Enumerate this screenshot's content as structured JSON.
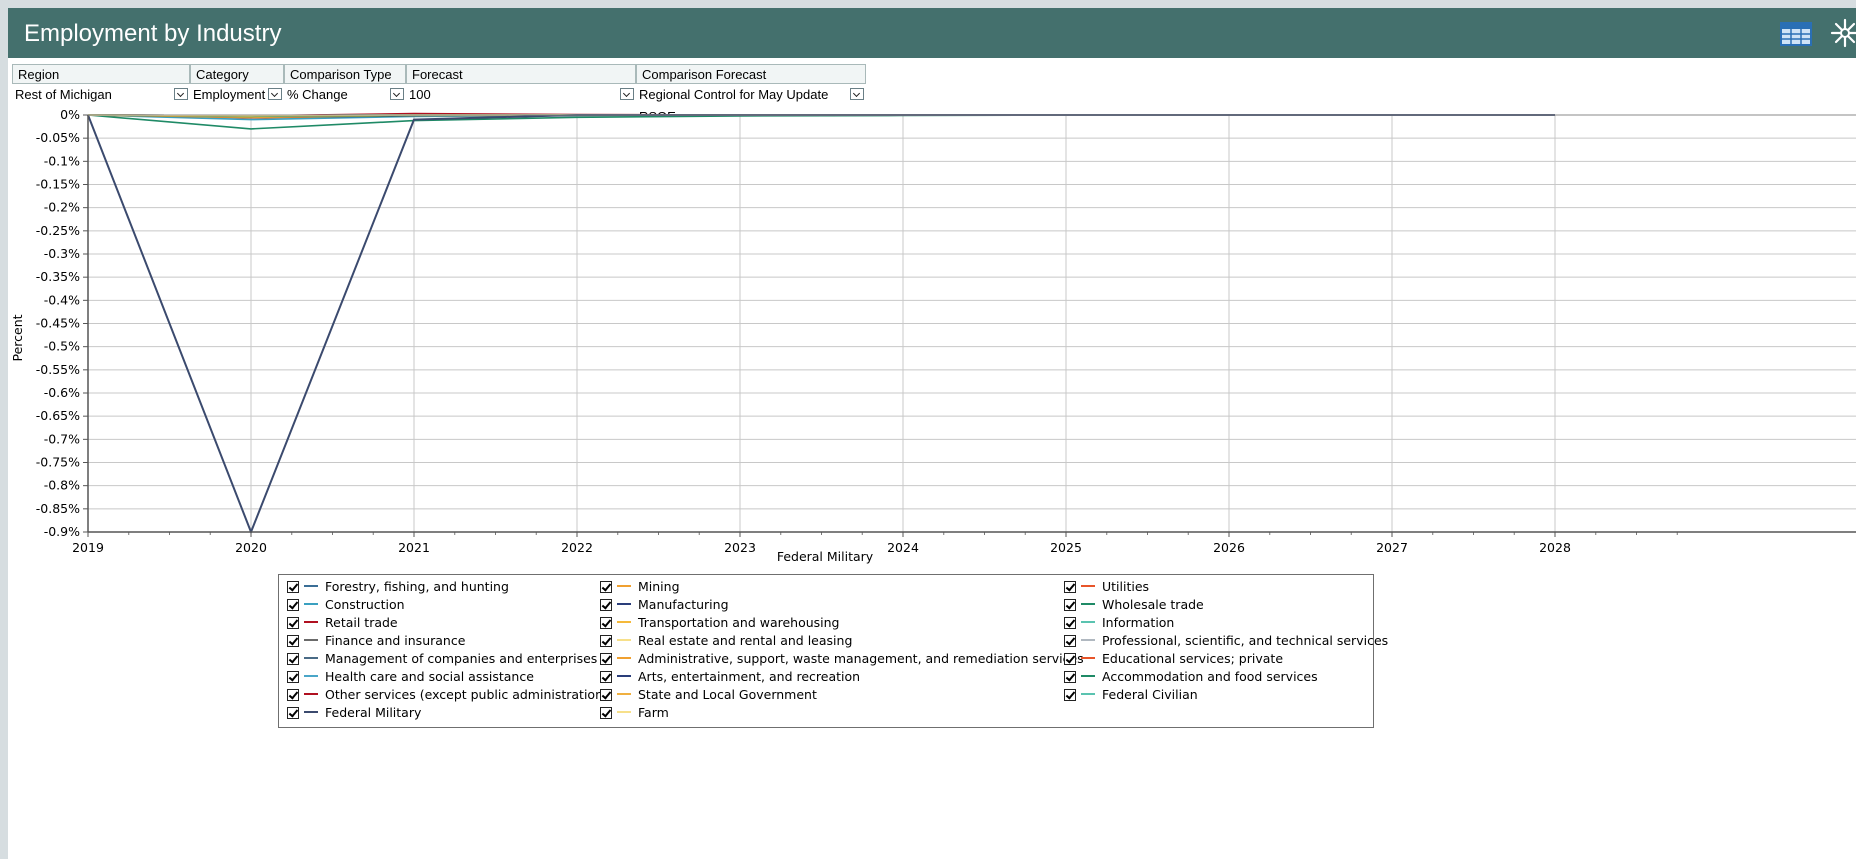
{
  "header": {
    "title": "Employment by Industry",
    "background": "#44706d",
    "table_icon": "table-grid-icon",
    "expand_icon": "expand-arrows-icon"
  },
  "selectors": {
    "region": {
      "label": "Region",
      "value": "Rest of Michigan"
    },
    "category": {
      "label": "Category",
      "value": "Employment"
    },
    "comparison_type": {
      "label": "Comparison Type",
      "value": "% Change"
    },
    "forecast": {
      "label": "Forecast",
      "value": "100"
    },
    "comparison_forecast": {
      "label": "Comparison Forecast",
      "value": "Regional Control for May Update RSQE"
    }
  },
  "chart_data": {
    "type": "line",
    "title": "",
    "xlabel": "Federal Military",
    "ylabel": "Percent",
    "x": [
      2019,
      2020,
      2021,
      2022,
      2023,
      2024,
      2025,
      2026,
      2027,
      2028
    ],
    "xlim": [
      2019,
      2028
    ],
    "ylim": [
      -0.9,
      0
    ],
    "y_ticks": [
      "0%",
      "-0.05%",
      "-0.1%",
      "-0.15%",
      "-0.2%",
      "-0.25%",
      "-0.3%",
      "-0.35%",
      "-0.4%",
      "-0.45%",
      "-0.5%",
      "-0.55%",
      "-0.6%",
      "-0.65%",
      "-0.7%",
      "-0.75%",
      "-0.8%",
      "-0.85%",
      "-0.9%"
    ],
    "x_ticks": [
      "2019",
      "2020",
      "2021",
      "2022",
      "2023",
      "2024",
      "2025",
      "2026",
      "2027",
      "2028"
    ],
    "grid": true,
    "legend_position": "bottom",
    "series": [
      {
        "name": "Forestry, fishing, and hunting",
        "color": "#3a6e96",
        "values": [
          0,
          -0.004,
          -0.001,
          0,
          0,
          0,
          0,
          0,
          0,
          0
        ]
      },
      {
        "name": "Mining",
        "color": "#f0a030",
        "values": [
          0,
          -0.003,
          -0.001,
          0,
          0,
          0,
          0,
          0,
          0,
          0
        ]
      },
      {
        "name": "Utilities",
        "color": "#e8552a",
        "values": [
          0,
          -0.006,
          -0.002,
          -0.001,
          0,
          0,
          0,
          0,
          0,
          0
        ]
      },
      {
        "name": "Construction",
        "color": "#3aa0c0",
        "values": [
          0,
          -0.01,
          -0.003,
          -0.001,
          0,
          0,
          0,
          0,
          0,
          0
        ]
      },
      {
        "name": "Manufacturing",
        "color": "#2a3d7a",
        "values": [
          0,
          -0.005,
          -0.002,
          0,
          0,
          0,
          0,
          0,
          0,
          0
        ]
      },
      {
        "name": "Wholesale trade",
        "color": "#1f8a66",
        "values": [
          0,
          -0.03,
          -0.012,
          -0.005,
          -0.002,
          -0.001,
          0,
          0,
          0,
          0
        ]
      },
      {
        "name": "Retail trade",
        "color": "#b01020",
        "values": [
          0,
          -0.002,
          0.003,
          0.001,
          0,
          0,
          0,
          0,
          0,
          0
        ]
      },
      {
        "name": "Transportation and warehousing",
        "color": "#f5b93a",
        "values": [
          0,
          -0.004,
          -0.001,
          0,
          0,
          0,
          0,
          0,
          0,
          0
        ]
      },
      {
        "name": "Information",
        "color": "#5ac3b0",
        "values": [
          0,
          -0.002,
          -0.001,
          0,
          0,
          0,
          0,
          0,
          0,
          0
        ]
      },
      {
        "name": "Finance and insurance",
        "color": "#6a6a6a",
        "values": [
          0,
          -0.001,
          0,
          0,
          0,
          0,
          0,
          0,
          0,
          0
        ]
      },
      {
        "name": "Real estate and rental and leasing",
        "color": "#f7e08a",
        "values": [
          0,
          -0.001,
          0,
          0,
          0,
          0,
          0,
          0,
          0,
          0
        ]
      },
      {
        "name": "Professional, scientific, and technical services",
        "color": "#b0b8c0",
        "values": [
          0,
          -0.003,
          -0.001,
          0,
          0,
          0,
          0,
          0,
          0,
          0
        ]
      },
      {
        "name": "Management of companies and enterprises",
        "color": "#4a6b86",
        "values": [
          0,
          -0.001,
          0,
          0,
          0,
          0,
          0,
          0,
          0,
          0
        ]
      },
      {
        "name": "Administrative, support, waste management, and remediation services",
        "color": "#f0a030",
        "values": [
          0,
          -0.005,
          -0.001,
          0,
          0,
          0,
          0,
          0,
          0,
          0
        ]
      },
      {
        "name": "Educational services; private",
        "color": "#e8552a",
        "values": [
          0,
          -0.002,
          0,
          0,
          0,
          0,
          0,
          0,
          0,
          0
        ]
      },
      {
        "name": "Health care and social assistance",
        "color": "#4aa6c8",
        "values": [
          0,
          -0.002,
          0,
          0,
          0,
          0,
          0,
          0,
          0,
          0
        ]
      },
      {
        "name": "Arts, entertainment, and recreation",
        "color": "#2a3d7a",
        "values": [
          0,
          -0.001,
          0,
          0,
          0,
          0,
          0,
          0,
          0,
          0
        ]
      },
      {
        "name": "Accommodation and food services",
        "color": "#1f8a66",
        "values": [
          0,
          -0.003,
          -0.001,
          0,
          0,
          0,
          0,
          0,
          0,
          0
        ]
      },
      {
        "name": "Other services (except public administration)",
        "color": "#b01020",
        "values": [
          0,
          -0.001,
          0,
          0,
          0,
          0,
          0,
          0,
          0,
          0
        ]
      },
      {
        "name": "State and Local Government",
        "color": "#f0b040",
        "values": [
          0,
          -0.002,
          0,
          0,
          0,
          0,
          0,
          0,
          0,
          0
        ]
      },
      {
        "name": "Federal Civilian",
        "color": "#5ac3b0",
        "values": [
          0,
          -0.001,
          0,
          0,
          0,
          0,
          0,
          0,
          0,
          0
        ]
      },
      {
        "name": "Federal Military",
        "color": "#3b4a6e",
        "values": [
          0,
          -0.9,
          -0.01,
          0,
          0,
          0,
          0,
          0,
          0,
          0
        ]
      },
      {
        "name": "Farm",
        "color": "#f7e08a",
        "values": [
          0,
          -0.001,
          0,
          0,
          0,
          0,
          0,
          0,
          0,
          0
        ]
      }
    ]
  },
  "legend": {
    "columns": [
      [
        "Forestry, fishing, and hunting",
        "Construction",
        "Retail trade",
        "Finance and insurance",
        "Management of companies and enterprises",
        "Health care and social assistance",
        "Other services (except public administration)",
        "Federal Military"
      ],
      [
        "Mining",
        "Manufacturing",
        "Transportation and warehousing",
        "Real estate and rental and leasing",
        "Administrative, support, waste management, and remediation services",
        "Arts, entertainment, and recreation",
        "State and Local Government",
        "Farm"
      ],
      [
        "Utilities",
        "Wholesale trade",
        "Information",
        "Professional, scientific, and technical services",
        "Educational services; private",
        "Accommodation and food services",
        "Federal Civilian"
      ]
    ],
    "checked": true
  }
}
